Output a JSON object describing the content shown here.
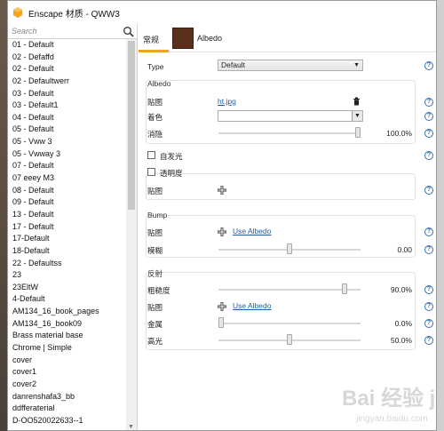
{
  "window": {
    "title": "Enscape 材质 - QWW3"
  },
  "search": {
    "placeholder": "Search"
  },
  "materials": [
    "01 - Default",
    "02 - Defaffd",
    "02 - Default",
    "02 - Defaultwerr",
    "03 - Default",
    "03 - Default1",
    "04 - Default",
    "05 - Default",
    "05 - Vww 3",
    "05 - Vwway 3",
    "07 - Default",
    "07 eeey M3",
    "08 - Default",
    "09 - Default",
    "13 - Default",
    "17 - Default",
    "17-Default",
    "18-Default",
    "22 - Defaultss",
    "23",
    "23EltW",
    "4-Default",
    "AM134_16_book_pages",
    "AM134_16_book09",
    "Brass material base",
    "Chrome | Simple",
    "cover",
    "cover1",
    "cover2",
    "danrenshafa3_bb",
    "ddfferaterial",
    "D-OO520022633--1"
  ],
  "tabs": {
    "general": "常规",
    "albedo": "Albedo"
  },
  "type": {
    "label": "Type",
    "value": "Default"
  },
  "albedo": {
    "title": "Albedo",
    "texture_label": "贴图",
    "texture_file": "ht.jpg",
    "tint_label": "着色",
    "fade_label": "消隐",
    "fade_value": "100.0%",
    "fade_fraction": 1.0
  },
  "self_illumination": {
    "label": "自发光"
  },
  "transparency": {
    "label": "透明度",
    "texture_label": "贴图"
  },
  "bump": {
    "title": "Bump",
    "texture_label": "贴图",
    "use_albedo": "Use Albedo",
    "blur_label": "模糊",
    "blur_value": "0.00",
    "blur_fraction": 0.5
  },
  "reflection": {
    "title": "反射",
    "roughness_label": "粗糙度",
    "roughness_value": "90.0%",
    "roughness_fraction": 0.9,
    "texture_label": "贴图",
    "use_albedo": "Use Albedo",
    "metallic_label": "金属",
    "metallic_value": "0.0%",
    "metallic_fraction": 0.0,
    "specular_label": "高光",
    "specular_value": "50.0%",
    "specular_fraction": 0.5
  },
  "help_glyph": "?",
  "watermark": "Bai 经验 jingyan.baidu.com",
  "colors": {
    "accent_tab": "#f0a41e",
    "link": "#1f5fa8",
    "help": "#3a6fb0",
    "albedo_swatch": "#5a2f1c"
  }
}
